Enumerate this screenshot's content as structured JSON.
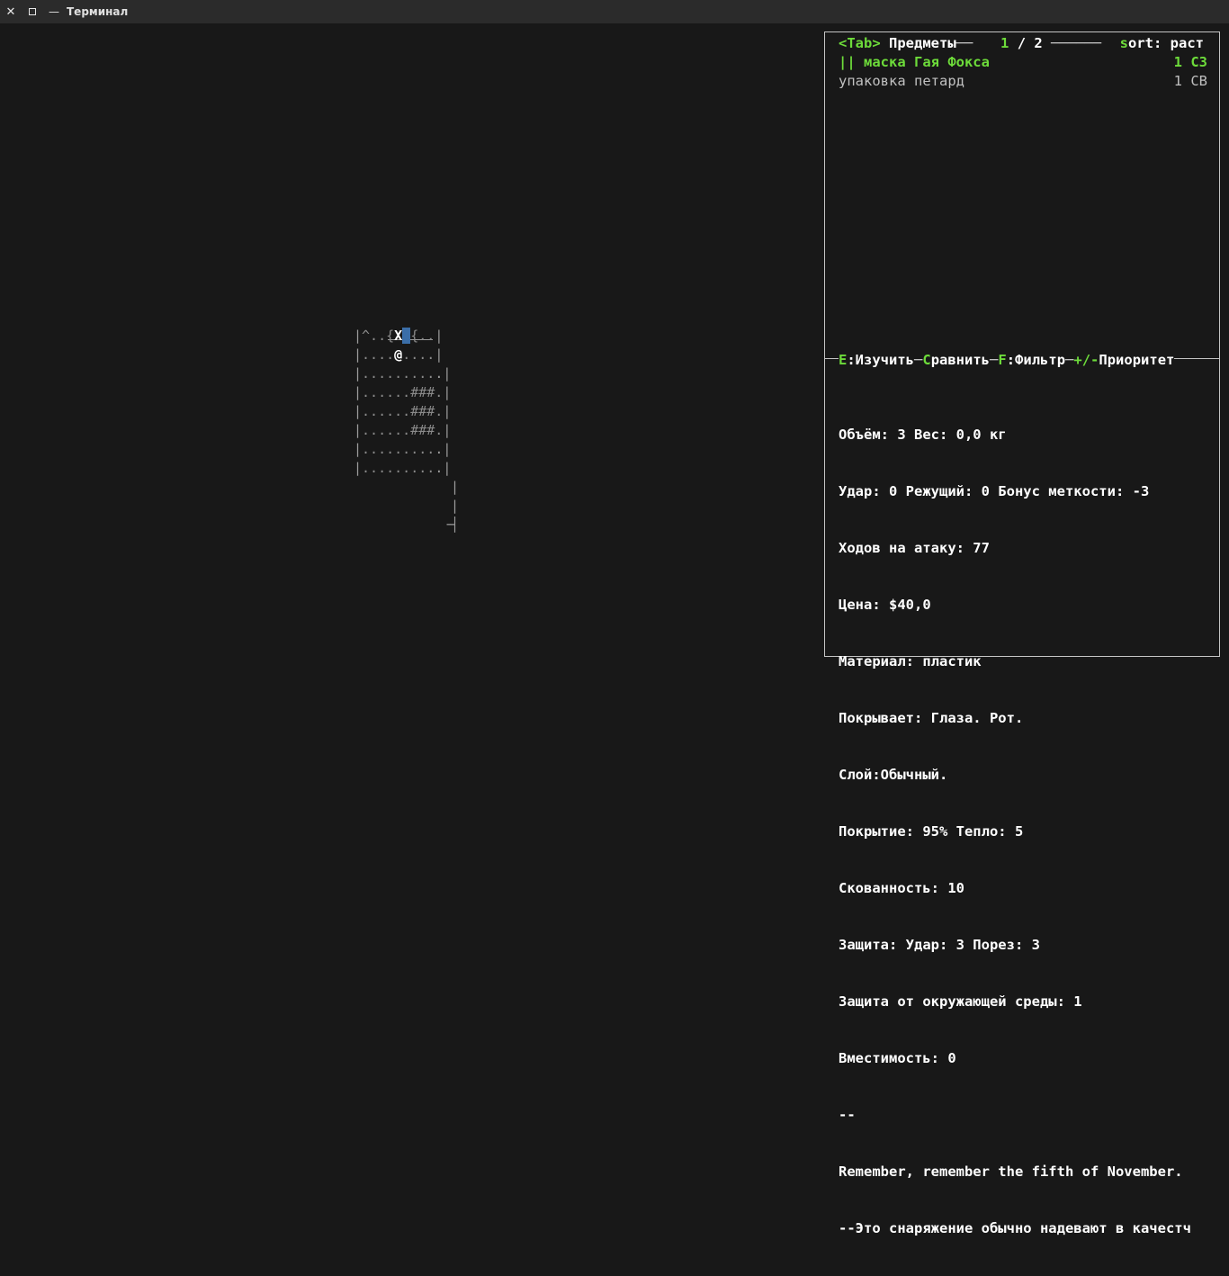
{
  "window": {
    "title": "Терминал",
    "close_glyph": "✕",
    "min_glyph": "—"
  },
  "map": {
    "row0": {
      "pre": "^..{",
      "player": "X",
      "cursor": "6",
      "post": "{..",
      "edge": "|"
    },
    "row1": "....@....",
    "rows": [
      ".........",
      "......###.",
      "......###.",
      "......###.",
      ".........",
      "........."
    ]
  },
  "inventory": {
    "tab_key": "<Tab>",
    "title": "Предметы",
    "page_current": "1",
    "page_sep": "/",
    "page_total": "2",
    "sort_key": "s",
    "sort_label": "ort: раст",
    "items": [
      {
        "name": "|| маска Гая Фокса",
        "qty": "1 СЗ",
        "selected": true
      },
      {
        "name": "упаковка петард",
        "qty": "1 СВ",
        "selected": false
      }
    ],
    "commands": [
      {
        "key": "E",
        "label": ":Изучить"
      },
      {
        "key": "C",
        "label": "равнить"
      },
      {
        "key": "F",
        "label": ":Фильтр"
      },
      {
        "key": "+/-",
        "label": "Приоритет"
      }
    ],
    "details": [
      "Объём: 3 Вес: 0,0 кг",
      "Удар: 0 Режущий: 0 Бонус меткости: -3",
      "Ходов на атаку: 77",
      "Цена: $40,0",
      "Материал: пластик",
      "Покрывает: Глаза. Рот.",
      "Слой:Обычный.",
      "Покрытие: 95% Тепло: 5",
      "Скованность: 10",
      "Защита: Удар: 3 Порез: 3",
      "Защита от окружающей среды: 1",
      "Вместимость: 0",
      "--",
      "Remember, remember the fifth of November.",
      "--Это снаряжение обычно надевают в качестч"
    ]
  },
  "colors": {
    "accent_green": "#6ddb3a",
    "background": "#181818",
    "titlebar": "#2b2b2b",
    "cursor": "#3b6ea8"
  }
}
